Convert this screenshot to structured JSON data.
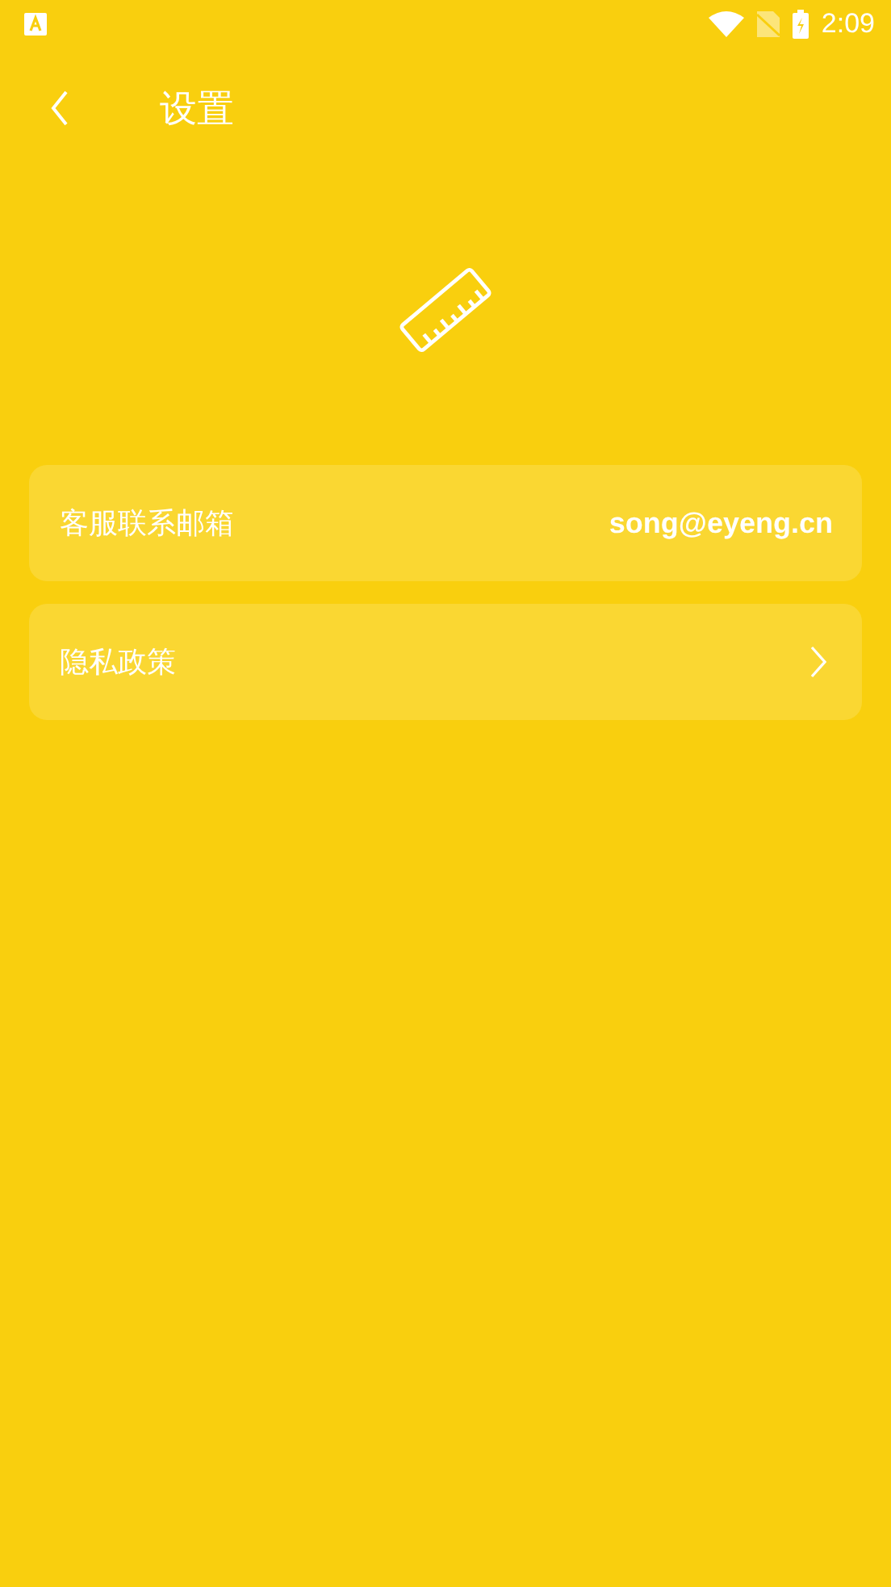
{
  "status_bar": {
    "time": "2:09"
  },
  "header": {
    "title": "设置"
  },
  "rows": [
    {
      "kind": "value",
      "label": "客服联系邮箱",
      "value": "song@eyeng.cn"
    },
    {
      "kind": "link",
      "label": "隐私政策"
    }
  ]
}
